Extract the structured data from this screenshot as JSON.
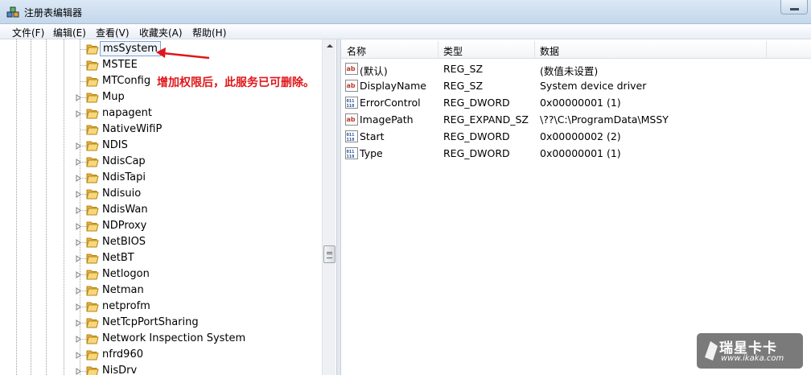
{
  "window": {
    "title": "注册表编辑器"
  },
  "menu": [
    "文件(F)",
    "编辑(E)",
    "查看(V)",
    "收藏夹(A)",
    "帮助(H)"
  ],
  "tree": {
    "items": [
      {
        "label": "msSystem",
        "expandable": false,
        "selected": true
      },
      {
        "label": "MSTEE",
        "expandable": false
      },
      {
        "label": "MTConfig",
        "expandable": false
      },
      {
        "label": "Mup",
        "expandable": true
      },
      {
        "label": "napagent",
        "expandable": true
      },
      {
        "label": "NativeWifiP",
        "expandable": false
      },
      {
        "label": "NDIS",
        "expandable": true
      },
      {
        "label": "NdisCap",
        "expandable": true
      },
      {
        "label": "NdisTapi",
        "expandable": true
      },
      {
        "label": "Ndisuio",
        "expandable": true
      },
      {
        "label": "NdisWan",
        "expandable": true
      },
      {
        "label": "NDProxy",
        "expandable": true
      },
      {
        "label": "NetBIOS",
        "expandable": true
      },
      {
        "label": "NetBT",
        "expandable": true
      },
      {
        "label": "Netlogon",
        "expandable": true
      },
      {
        "label": "Netman",
        "expandable": true
      },
      {
        "label": "netprofm",
        "expandable": true
      },
      {
        "label": "NetTcpPortSharing",
        "expandable": true
      },
      {
        "label": "Network Inspection System",
        "expandable": true
      },
      {
        "label": "nfrd960",
        "expandable": true
      },
      {
        "label": "NisDrv",
        "expandable": true
      }
    ]
  },
  "list": {
    "columns": [
      "名称",
      "类型",
      "数据"
    ],
    "rows": [
      {
        "icon": "string-value-icon",
        "name": "(默认)",
        "type": "REG_SZ",
        "data": "(数值未设置)"
      },
      {
        "icon": "string-value-icon",
        "name": "DisplayName",
        "type": "REG_SZ",
        "data": "System device driver"
      },
      {
        "icon": "binary-value-icon",
        "name": "ErrorControl",
        "type": "REG_DWORD",
        "data": "0x00000001 (1)"
      },
      {
        "icon": "string-value-icon",
        "name": "ImagePath",
        "type": "REG_EXPAND_SZ",
        "data": "\\??\\C:\\ProgramData\\MSSY"
      },
      {
        "icon": "binary-value-icon",
        "name": "Start",
        "type": "REG_DWORD",
        "data": "0x00000002 (2)"
      },
      {
        "icon": "binary-value-icon",
        "name": "Type",
        "type": "REG_DWORD",
        "data": "0x00000001 (1)"
      }
    ]
  },
  "annotation": {
    "text": "增加权限后，此服务已可删除。",
    "color": "#e0161a"
  },
  "watermark": {
    "title": "瑞星卡卡",
    "url": "www.ikaka.com"
  }
}
